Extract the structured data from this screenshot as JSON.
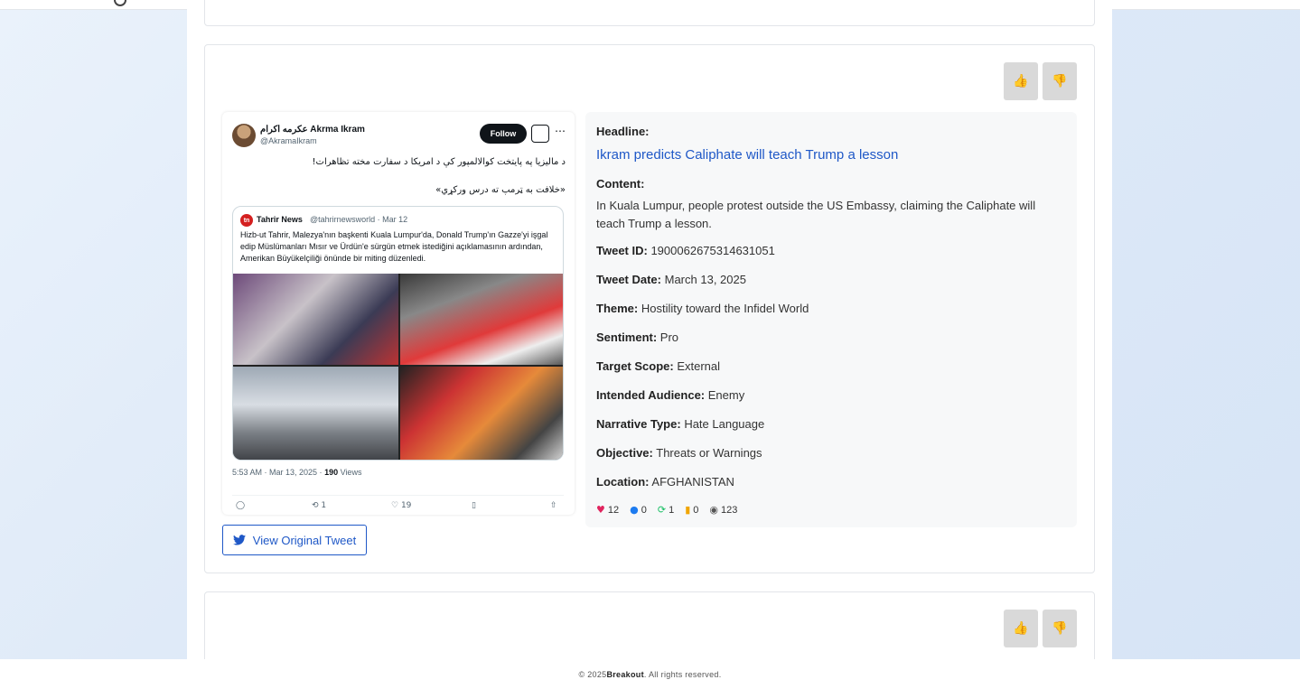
{
  "card": {
    "vote_up": "👍",
    "vote_down": "👎",
    "view_original": "View Original Tweet",
    "tweet_screenshot": {
      "author_name": "عکرمه اکرام Akrma Ikram",
      "author_handle": "@AkramaIkram",
      "follow": "Follow",
      "text_line1": "د مالیزیا په پایتخت کوالالمپور کې د امریکا د سفارت مخته تظاهرات!",
      "text_line2": "«خلافت به ټرمپ ته درس ورکړي»",
      "quote_logo": "tn",
      "quote_name": "Tahrir News",
      "quote_meta": "@tahrirnewsworld · Mar 12",
      "quote_text": "Hizb-ut Tahrir, Malezya'nın başkenti Kuala Lumpur'da, Donald Trump'ın Gazze'yi işgal edip Müslümanları Mısır ve Ürdün'e sürgün etmek istediğini açıklamasının ardından, Amerikan Büyükelçiliği önünde bir miting düzenledi.",
      "time": "5:53 AM · Mar 13, 2025 · ",
      "views_count": "190",
      "views_label": " Views",
      "retweets": "1",
      "likes": "19"
    },
    "headline_label": "Headline:",
    "headline": "Ikram predicts Caliphate will teach Trump a lesson",
    "content_label": "Content:",
    "content": "In Kuala Lumpur, people protest outside the US Embassy, claiming the Caliphate will teach Trump a lesson.",
    "fields": [
      {
        "label": "Tweet ID:",
        "value": "1900062675314631051"
      },
      {
        "label": "Tweet Date:",
        "value": "March 13, 2025"
      },
      {
        "label": "Theme:",
        "value": "Hostility toward the Infidel World"
      },
      {
        "label": "Sentiment:",
        "value": "Pro"
      },
      {
        "label": "Target Scope:",
        "value": "External"
      },
      {
        "label": "Intended Audience:",
        "value": "Enemy"
      },
      {
        "label": "Narrative Type:",
        "value": "Hate Language"
      },
      {
        "label": "Objective:",
        "value": "Threats or Warnings"
      },
      {
        "label": "Location:",
        "value": "AFGHANISTAN"
      }
    ],
    "stats": {
      "likes": "12",
      "comments": "0",
      "retweets": "1",
      "bookmarks": "0",
      "views": "123"
    }
  },
  "next_card": {
    "vote_up": "👍",
    "vote_down": "👎"
  },
  "footer": {
    "prefix": "© 2025 ",
    "brand": "Breakout",
    "suffix": ". All rights reserved."
  },
  "colors": {
    "accent": "#1f58c7",
    "heart": "#e0245e",
    "comment": "#1d7bf0",
    "retweet": "#17bf63",
    "bookmark": "#f0a500"
  }
}
